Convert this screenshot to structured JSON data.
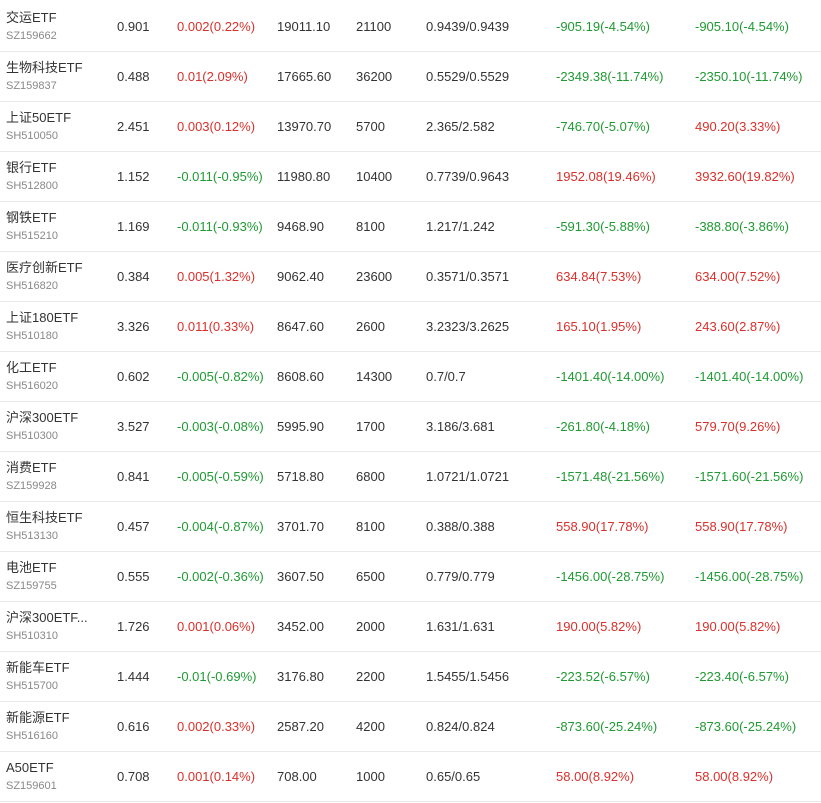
{
  "colors": {
    "up": "#d9302b",
    "down": "#1f9a33",
    "text": "#333333",
    "code": "#888888",
    "divider": "#e9e9e9"
  },
  "rows": [
    {
      "name": "交运ETF",
      "code": "SZ159662",
      "price": "0.901",
      "change": "0.002(0.22%)",
      "change_dir": "up",
      "value": "19011.10",
      "shares": "21100",
      "cost": "0.9439/0.9439",
      "today_pnl": "-905.19(-4.54%)",
      "today_dir": "down",
      "total_pnl": "-905.10(-4.54%)",
      "total_dir": "down"
    },
    {
      "name": "生物科技ETF",
      "code": "SZ159837",
      "price": "0.488",
      "change": "0.01(2.09%)",
      "change_dir": "up",
      "value": "17665.60",
      "shares": "36200",
      "cost": "0.5529/0.5529",
      "today_pnl": "-2349.38(-11.74%)",
      "today_dir": "down",
      "total_pnl": "-2350.10(-11.74%)",
      "total_dir": "down"
    },
    {
      "name": "上证50ETF",
      "code": "SH510050",
      "price": "2.451",
      "change": "0.003(0.12%)",
      "change_dir": "up",
      "value": "13970.70",
      "shares": "5700",
      "cost": "2.365/2.582",
      "today_pnl": "-746.70(-5.07%)",
      "today_dir": "down",
      "total_pnl": "490.20(3.33%)",
      "total_dir": "up"
    },
    {
      "name": "银行ETF",
      "code": "SH512800",
      "price": "1.152",
      "change": "-0.011(-0.95%)",
      "change_dir": "down",
      "value": "11980.80",
      "shares": "10400",
      "cost": "0.7739/0.9643",
      "today_pnl": "1952.08(19.46%)",
      "today_dir": "up",
      "total_pnl": "3932.60(19.82%)",
      "total_dir": "up"
    },
    {
      "name": "钢铁ETF",
      "code": "SH515210",
      "price": "1.169",
      "change": "-0.011(-0.93%)",
      "change_dir": "down",
      "value": "9468.90",
      "shares": "8100",
      "cost": "1.217/1.242",
      "today_pnl": "-591.30(-5.88%)",
      "today_dir": "down",
      "total_pnl": "-388.80(-3.86%)",
      "total_dir": "down"
    },
    {
      "name": "医疗创新ETF",
      "code": "SH516820",
      "price": "0.384",
      "change": "0.005(1.32%)",
      "change_dir": "up",
      "value": "9062.40",
      "shares": "23600",
      "cost": "0.3571/0.3571",
      "today_pnl": "634.84(7.53%)",
      "today_dir": "up",
      "total_pnl": "634.00(7.52%)",
      "total_dir": "up"
    },
    {
      "name": "上证180ETF",
      "code": "SH510180",
      "price": "3.326",
      "change": "0.011(0.33%)",
      "change_dir": "up",
      "value": "8647.60",
      "shares": "2600",
      "cost": "3.2323/3.2625",
      "today_pnl": "165.10(1.95%)",
      "today_dir": "up",
      "total_pnl": "243.60(2.87%)",
      "total_dir": "up"
    },
    {
      "name": "化工ETF",
      "code": "SH516020",
      "price": "0.602",
      "change": "-0.005(-0.82%)",
      "change_dir": "down",
      "value": "8608.60",
      "shares": "14300",
      "cost": "0.7/0.7",
      "today_pnl": "-1401.40(-14.00%)",
      "today_dir": "down",
      "total_pnl": "-1401.40(-14.00%)",
      "total_dir": "down"
    },
    {
      "name": "沪深300ETF",
      "code": "SH510300",
      "price": "3.527",
      "change": "-0.003(-0.08%)",
      "change_dir": "down",
      "value": "5995.90",
      "shares": "1700",
      "cost": "3.186/3.681",
      "today_pnl": "-261.80(-4.18%)",
      "today_dir": "down",
      "total_pnl": "579.70(9.26%)",
      "total_dir": "up"
    },
    {
      "name": "消费ETF",
      "code": "SZ159928",
      "price": "0.841",
      "change": "-0.005(-0.59%)",
      "change_dir": "down",
      "value": "5718.80",
      "shares": "6800",
      "cost": "1.0721/1.0721",
      "today_pnl": "-1571.48(-21.56%)",
      "today_dir": "down",
      "total_pnl": "-1571.60(-21.56%)",
      "total_dir": "down"
    },
    {
      "name": "恒生科技ETF",
      "code": "SH513130",
      "price": "0.457",
      "change": "-0.004(-0.87%)",
      "change_dir": "down",
      "value": "3701.70",
      "shares": "8100",
      "cost": "0.388/0.388",
      "today_pnl": "558.90(17.78%)",
      "today_dir": "up",
      "total_pnl": "558.90(17.78%)",
      "total_dir": "up"
    },
    {
      "name": "电池ETF",
      "code": "SZ159755",
      "price": "0.555",
      "change": "-0.002(-0.36%)",
      "change_dir": "down",
      "value": "3607.50",
      "shares": "6500",
      "cost": "0.779/0.779",
      "today_pnl": "-1456.00(-28.75%)",
      "today_dir": "down",
      "total_pnl": "-1456.00(-28.75%)",
      "total_dir": "down"
    },
    {
      "name": "沪深300ETF...",
      "code": "SH510310",
      "price": "1.726",
      "change": "0.001(0.06%)",
      "change_dir": "up",
      "value": "3452.00",
      "shares": "2000",
      "cost": "1.631/1.631",
      "today_pnl": "190.00(5.82%)",
      "today_dir": "up",
      "total_pnl": "190.00(5.82%)",
      "total_dir": "up"
    },
    {
      "name": "新能车ETF",
      "code": "SH515700",
      "price": "1.444",
      "change": "-0.01(-0.69%)",
      "change_dir": "down",
      "value": "3176.80",
      "shares": "2200",
      "cost": "1.5455/1.5456",
      "today_pnl": "-223.52(-6.57%)",
      "today_dir": "down",
      "total_pnl": "-223.40(-6.57%)",
      "total_dir": "down"
    },
    {
      "name": "新能源ETF",
      "code": "SH516160",
      "price": "0.616",
      "change": "0.002(0.33%)",
      "change_dir": "up",
      "value": "2587.20",
      "shares": "4200",
      "cost": "0.824/0.824",
      "today_pnl": "-873.60(-25.24%)",
      "today_dir": "down",
      "total_pnl": "-873.60(-25.24%)",
      "total_dir": "down"
    },
    {
      "name": "A50ETF",
      "code": "SZ159601",
      "price": "0.708",
      "change": "0.001(0.14%)",
      "change_dir": "up",
      "value": "708.00",
      "shares": "1000",
      "cost": "0.65/0.65",
      "today_pnl": "58.00(8.92%)",
      "today_dir": "up",
      "total_pnl": "58.00(8.92%)",
      "total_dir": "up"
    }
  ]
}
